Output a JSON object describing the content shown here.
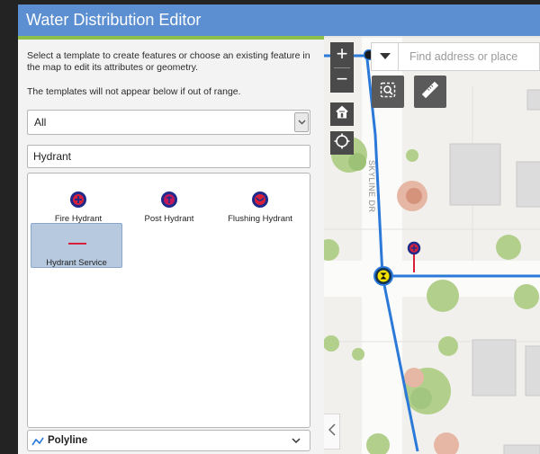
{
  "window": {
    "title": "Water Distribution Editor"
  },
  "panel": {
    "instruction_1": "Select a template to create features or choose an existing feature in the map to edit its attributes or geometry.",
    "instruction_2": "The templates will not appear below if out of range.",
    "filter": {
      "selected": "All"
    },
    "search": {
      "value": "Hydrant"
    },
    "templates": [
      {
        "label": "Fire Hydrant",
        "icon": "fire-hydrant-icon"
      },
      {
        "label": "Post Hydrant",
        "icon": "post-hydrant-icon"
      },
      {
        "label": "Flushing Hydrant",
        "icon": "flushing-hydrant-icon"
      },
      {
        "label": "Hydrant Service",
        "icon": "hydrant-service-line-icon",
        "selected": true
      }
    ],
    "geometry": {
      "label": "Polyline",
      "icon": "polyline-icon"
    }
  },
  "map": {
    "zoom_in": "+",
    "zoom_out": "−",
    "search_placeholder": "Find address or place",
    "street_label": "SKYLINE DR",
    "controls": [
      "home-icon",
      "locate-icon",
      "select-extent-icon",
      "measure-ruler-icon",
      "chevron-left-icon"
    ]
  },
  "colors": {
    "title_bar": "#5b8fd1",
    "accent": "#8dbf4a",
    "water_main": "#2b79d8",
    "hydrant_red": "#d8203a",
    "selected_template": "#b6c9df"
  }
}
